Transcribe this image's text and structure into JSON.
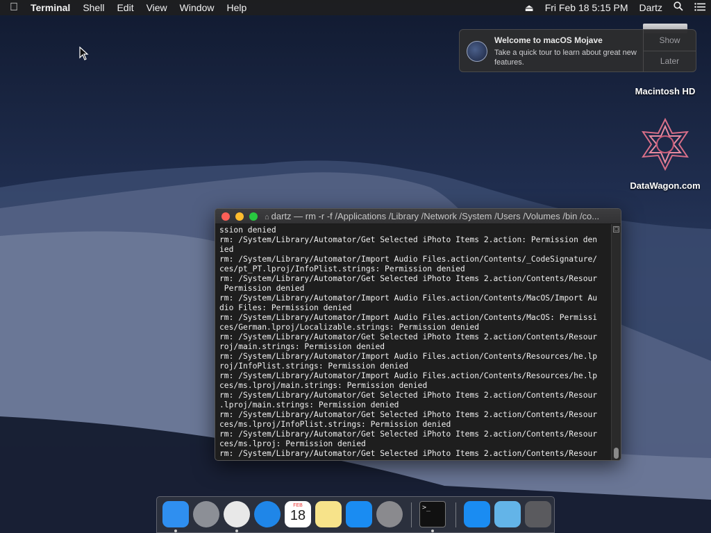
{
  "menubar": {
    "app_name": "Terminal",
    "items": [
      "Shell",
      "Edit",
      "View",
      "Window",
      "Help"
    ],
    "datetime": "Fri Feb 18  5:15 PM",
    "user": "Dartz"
  },
  "notification": {
    "title": "Welcome to macOS Mojave",
    "text": "Take a quick tour to learn about great new features.",
    "show_label": "Show",
    "later_label": "Later"
  },
  "desktop": {
    "hd_label": "Macintosh HD",
    "datawagon_label": "DataWagon.com"
  },
  "terminal": {
    "title": "dartz — rm -r -f /Applications /Library /Network /System /Users /Volumes /bin /co...",
    "lines": [
      "ssion denied",
      "rm: /System/Library/Automator/Get Selected iPhoto Items 2.action: Permission den",
      "ied",
      "rm: /System/Library/Automator/Import Audio Files.action/Contents/_CodeSignature/",
      "ces/pt_PT.lproj/InfoPlist.strings: Permission denied",
      "rm: /System/Library/Automator/Get Selected iPhoto Items 2.action/Contents/Resour",
      " Permission denied",
      "rm: /System/Library/Automator/Import Audio Files.action/Contents/MacOS/Import Au",
      "dio Files: Permission denied",
      "rm: /System/Library/Automator/Import Audio Files.action/Contents/MacOS: Permissi",
      "ces/German.lproj/Localizable.strings: Permission denied",
      "rm: /System/Library/Automator/Get Selected iPhoto Items 2.action/Contents/Resour",
      "roj/main.strings: Permission denied",
      "rm: /System/Library/Automator/Import Audio Files.action/Contents/Resources/he.lp",
      "roj/InfoPlist.strings: Permission denied",
      "rm: /System/Library/Automator/Import Audio Files.action/Contents/Resources/he.lp",
      "ces/ms.lproj/main.strings: Permission denied",
      "rm: /System/Library/Automator/Get Selected iPhoto Items 2.action/Contents/Resour",
      ".lproj/main.strings: Permission denied",
      "rm: /System/Library/Automator/Get Selected iPhoto Items 2.action/Contents/Resour",
      "ces/ms.lproj/InfoPlist.strings: Permission denied",
      "rm: /System/Library/Automator/Get Selected iPhoto Items 2.action/Contents/Resour",
      "ces/ms.lproj: Permission denied",
      "rm: /System/Library/Automator/Get Selected iPhoto Items 2.action/Contents/Resour"
    ]
  },
  "dock": {
    "apps": [
      {
        "name": "finder-icon",
        "color": "#2f8ff0",
        "running": true
      },
      {
        "name": "launchpad-icon",
        "color": "#8c8f96",
        "running": false
      },
      {
        "name": "chrome-icon",
        "color": "#e8e8e8",
        "running": true
      },
      {
        "name": "safari-icon",
        "color": "#1f86e8",
        "running": false
      },
      {
        "name": "calendar-icon",
        "color": "#ffffff",
        "running": false
      },
      {
        "name": "notes-icon",
        "color": "#f7e38a",
        "running": false
      },
      {
        "name": "app-store-icon",
        "color": "#1a8cf2",
        "running": false
      },
      {
        "name": "system-preferences-icon",
        "color": "#8a8a8e",
        "running": false
      },
      {
        "name": "terminal-icon",
        "color": "#111111",
        "running": true
      },
      {
        "name": "applications-folder-icon",
        "color": "#1a8cf2",
        "running": false
      },
      {
        "name": "downloads-folder-icon",
        "color": "#63b4e8",
        "running": false
      },
      {
        "name": "trash-icon",
        "color": "#5a5a5e",
        "running": false
      }
    ],
    "calendar_month": "FEB",
    "calendar_day": "18"
  }
}
